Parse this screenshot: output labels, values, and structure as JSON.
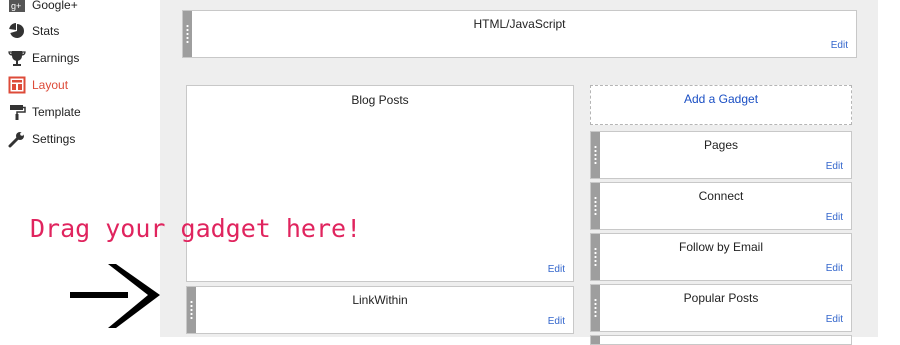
{
  "sidebar": {
    "items": [
      {
        "label": "Google+",
        "icon": "google-plus-icon"
      },
      {
        "label": "Stats",
        "icon": "pie-chart-icon"
      },
      {
        "label": "Earnings",
        "icon": "trophy-icon"
      },
      {
        "label": "Layout",
        "icon": "layout-icon",
        "active": true
      },
      {
        "label": "Template",
        "icon": "paint-roller-icon"
      },
      {
        "label": "Settings",
        "icon": "wrench-icon"
      }
    ],
    "active_color": "#dd4b39"
  },
  "layout": {
    "header_gadget": {
      "title": "HTML/JavaScript",
      "edit": "Edit"
    },
    "main_column": [
      {
        "title": "Blog Posts",
        "edit": "Edit"
      },
      {
        "title": "LinkWithin",
        "edit": "Edit"
      }
    ],
    "sidebar_column": {
      "add_gadget": "Add a Gadget",
      "gadgets": [
        {
          "title": "Pages",
          "edit": "Edit"
        },
        {
          "title": "Connect",
          "edit": "Edit"
        },
        {
          "title": "Follow by Email",
          "edit": "Edit"
        },
        {
          "title": "Popular Posts",
          "edit": "Edit"
        }
      ]
    }
  },
  "annotation": {
    "text": "Drag your gadget here!",
    "color": "#e0245e"
  }
}
